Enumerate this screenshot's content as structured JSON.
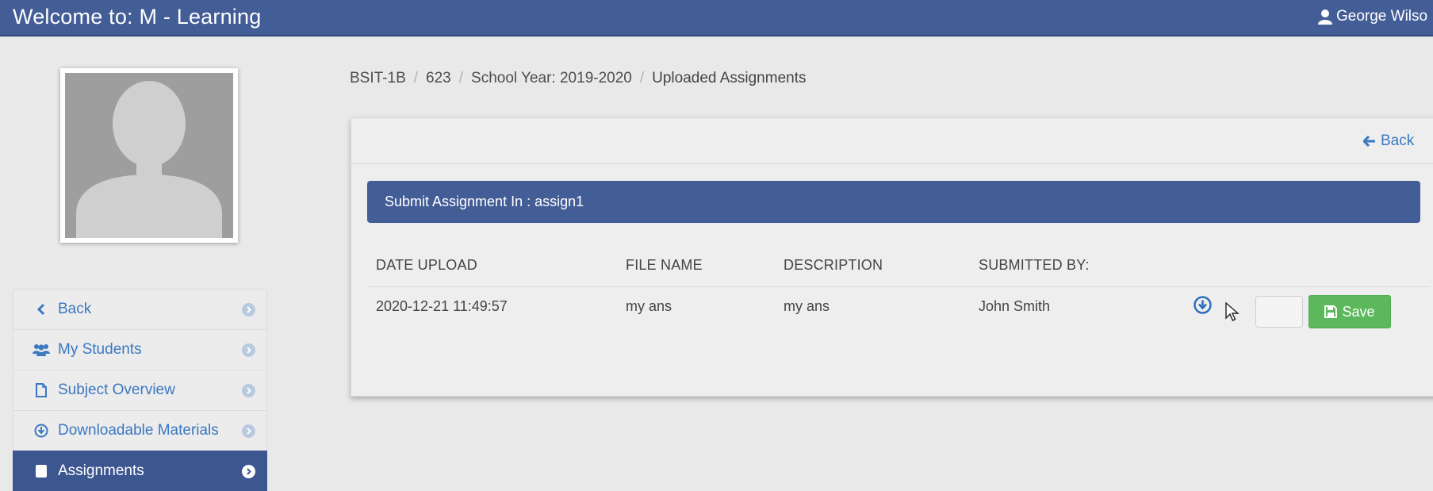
{
  "header": {
    "title": "Welcome to: M - Learning",
    "user_name": "George Wilso"
  },
  "sidebar": {
    "items": [
      {
        "label": "Back",
        "icon": "chevron-left-icon"
      },
      {
        "label": "My Students",
        "icon": "users-icon"
      },
      {
        "label": "Subject Overview",
        "icon": "file-icon"
      },
      {
        "label": "Downloadable Materials",
        "icon": "download-circle-icon"
      },
      {
        "label": "Assignments",
        "icon": "book-icon",
        "active": true
      }
    ]
  },
  "breadcrumb": {
    "items": [
      "BSIT-1B",
      "623",
      "School Year: 2019-2020"
    ],
    "current": "Uploaded Assignments"
  },
  "panel": {
    "back_label": "Back",
    "heading": "Submit Assignment In : assign1",
    "table": {
      "columns": [
        "DATE UPLOAD",
        "FILE NAME",
        "DESCRIPTION",
        "SUBMITTED BY:"
      ],
      "rows": [
        {
          "date_upload": "2020-12-21 11:49:57",
          "file_name": "my ans",
          "description": "my ans",
          "submitted_by": "John Smith",
          "grade_value": ""
        }
      ]
    },
    "save_label": "Save"
  },
  "colors": {
    "header": "#435d97",
    "link": "#3b78c2",
    "save": "#5cb85c",
    "sidebar_active": "#3c5690"
  }
}
